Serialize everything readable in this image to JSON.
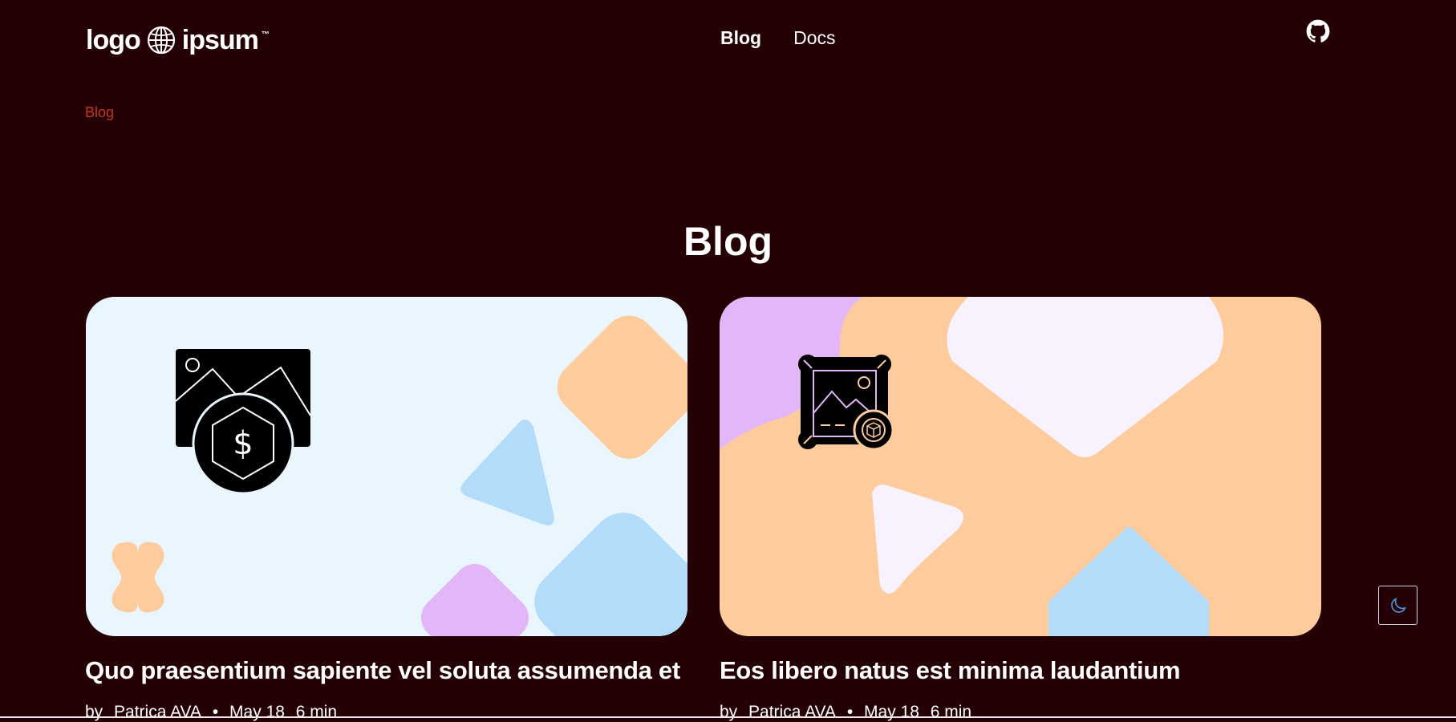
{
  "header": {
    "logo_left": "logo",
    "logo_right": "ipsum",
    "logo_tm": "™",
    "nav": [
      {
        "label": "Blog",
        "active": true
      },
      {
        "label": "Docs",
        "active": false
      }
    ],
    "github_icon": "github-icon"
  },
  "breadcrumb": "Blog",
  "page_title": "Blog",
  "posts": [
    {
      "title": "Quo praesentium sapiente vel soluta assumenda et",
      "by": "by",
      "author": "Patrica AVA",
      "separator": "•",
      "date": "May 18",
      "read_time": "6 min",
      "icon": "image-dollar-icon",
      "background": "#eaf6fd"
    },
    {
      "title": "Eos libero natus est minima laudantium",
      "by": "by",
      "author": "Patrica AVA",
      "separator": "•",
      "date": "May 18",
      "read_time": "6 min",
      "icon": "image-frame-cube-icon",
      "background": "#fecb9c"
    }
  ],
  "theme_toggle_icon": "moon-icon",
  "colors": {
    "background": "#240005",
    "breadcrumb": "#c0391b",
    "peach": "#fecb9c",
    "light_blue": "#b3dbfa",
    "lavender": "#e3b6f7",
    "pale_lilac": "#f7f2fe",
    "moon": "#4d8dd8"
  }
}
